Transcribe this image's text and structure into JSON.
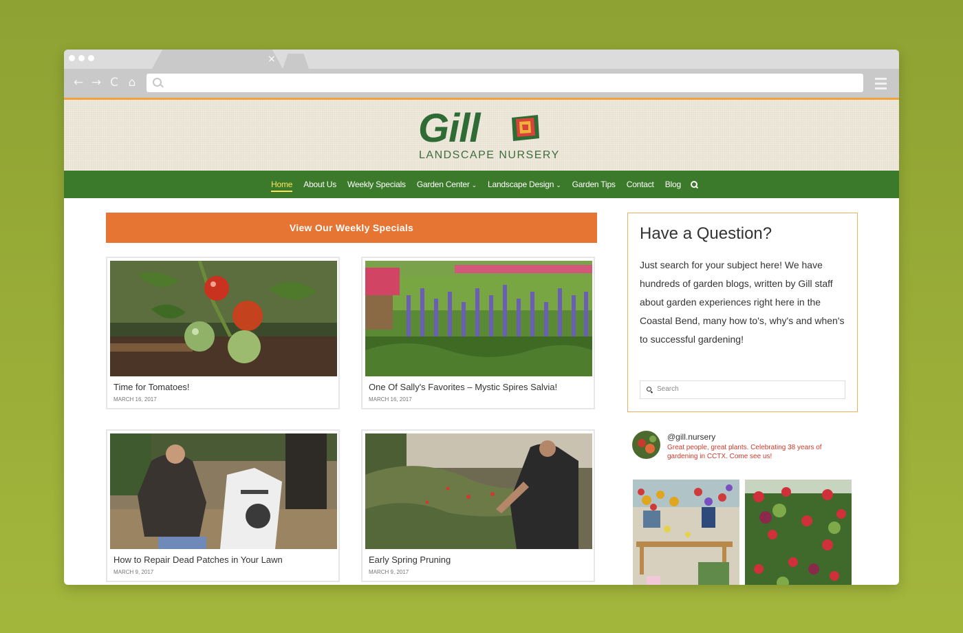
{
  "browser": {
    "tab_close": "×",
    "nav_back": "←",
    "nav_forward": "→",
    "nav_reload": "C",
    "nav_home": "⌂"
  },
  "logo": {
    "wordmark": "Gill",
    "subtitle": "LANDSCAPE NURSERY"
  },
  "nav": {
    "items": [
      {
        "label": "Home",
        "active": true,
        "dropdown": false
      },
      {
        "label": "About Us",
        "active": false,
        "dropdown": false
      },
      {
        "label": "Weekly Specials",
        "active": false,
        "dropdown": false
      },
      {
        "label": "Garden Center",
        "active": false,
        "dropdown": true
      },
      {
        "label": "Landscape Design",
        "active": false,
        "dropdown": true
      },
      {
        "label": "Garden Tips",
        "active": false,
        "dropdown": false
      },
      {
        "label": "Contact",
        "active": false,
        "dropdown": false
      },
      {
        "label": "Blog",
        "active": false,
        "dropdown": false
      }
    ],
    "dropdown_glyph": "⌄"
  },
  "main": {
    "specials_button": "View Our Weekly Specials",
    "posts": [
      {
        "title": "Time for Tomatoes!",
        "date": "MARCH 16, 2017"
      },
      {
        "title": "One Of Sally's Favorites – Mystic Spires Salvia!",
        "date": "MARCH 16, 2017"
      },
      {
        "title": "How to Repair Dead Patches in Your Lawn",
        "date": "MARCH 9, 2017"
      },
      {
        "title": "Early Spring Pruning",
        "date": "MARCH 9, 2017"
      }
    ]
  },
  "sidebar": {
    "question_title": "Have a Question?",
    "question_text": "Just search for your subject here! We have hundreds of garden blogs, written by Gill staff about garden experiences right here in the Coastal Bend, many how to's, why's and when's to successful gardening!",
    "search_placeholder": "Search",
    "instagram": {
      "handle": "@gill.nursery",
      "bio": "Great people, great plants. Celebrating 38 years of gardening in CCTX. Come see us!"
    }
  },
  "colors": {
    "nav_green": "#3b7a2a",
    "specials_orange": "#e67432",
    "active_nav": "#ffe45a",
    "accent_line": "#f2a23a",
    "bio_red": "#d0392b"
  }
}
